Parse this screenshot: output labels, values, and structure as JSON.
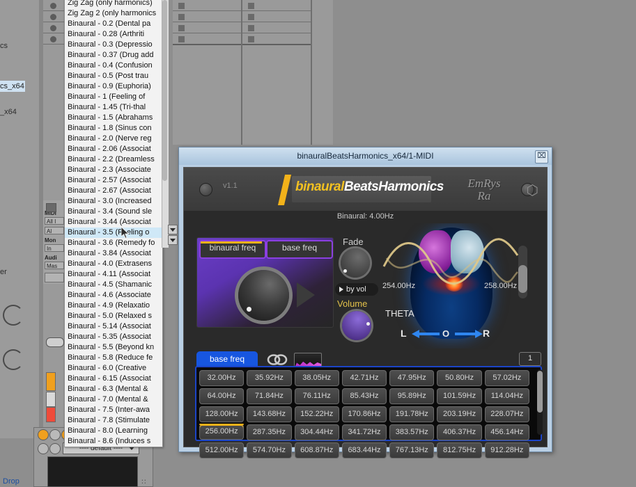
{
  "daw": {
    "browser": {
      "text_1": "cs",
      "selected_item": "cs_x64",
      "text_2": "_x64",
      "text_3": "er"
    },
    "mixer": {
      "midi_from_label": "MIDI",
      "midi_from_value": "All I",
      "midi_channel_value": "Al",
      "monitor_label": "Mon",
      "monitor_value": "In",
      "audio_to_label": "Audi",
      "audio_to_value": "Mas"
    },
    "rack": {
      "preset_value": "---- default ----",
      "drop_label": "Drop",
      "grip": "∶∶"
    }
  },
  "preset_list": {
    "items": [
      {
        "label": "Zig Zag (only harmonics)",
        "selected": false
      },
      {
        "label": "Zig Zag 2 (only harmonics",
        "selected": false
      },
      {
        "label": "Binaural - 0.2 (Dental pa",
        "selected": false
      },
      {
        "label": "Binaural - 0.28 (Arthriti",
        "selected": false
      },
      {
        "label": "Binaural - 0.3 (Depressio",
        "selected": false
      },
      {
        "label": "Binaural - 0.37 (Drug add",
        "selected": false
      },
      {
        "label": "Binaural - 0.4 (Confusion",
        "selected": false
      },
      {
        "label": "Binaural - 0.5 (Post trau",
        "selected": false
      },
      {
        "label": "Binaural - 0.9 (Euphoria)",
        "selected": false
      },
      {
        "label": "Binaural - 1 (Feeling of",
        "selected": false
      },
      {
        "label": "Binaural - 1.45 (Tri-thal",
        "selected": false
      },
      {
        "label": "Binaural - 1.5 (Abrahams",
        "selected": false
      },
      {
        "label": "Binaural - 1.8 (Sinus con",
        "selected": false
      },
      {
        "label": "Binaural - 2.0 (Nerve reg",
        "selected": false
      },
      {
        "label": "Binaural - 2.06 (Associat",
        "selected": false
      },
      {
        "label": "Binaural - 2.2 (Dreamless",
        "selected": false
      },
      {
        "label": "Binaural - 2.3 (Associate",
        "selected": false
      },
      {
        "label": "Binaural - 2.57 (Associat",
        "selected": false
      },
      {
        "label": "Binaural - 2.67 (Associat",
        "selected": false
      },
      {
        "label": "Binaural - 3.0 (Increased",
        "selected": false
      },
      {
        "label": "Binaural - 3.4 (Sound sle",
        "selected": false
      },
      {
        "label": "Binaural - 3.44 (Associat",
        "selected": false
      },
      {
        "label": "Binaural - 3.5 (Feeling o",
        "selected": true
      },
      {
        "label": "Binaural - 3.6 (Remedy fo",
        "selected": false
      },
      {
        "label": "Binaural - 3.84 (Associat",
        "selected": false
      },
      {
        "label": "Binaural - 4.0 (Extrasens",
        "selected": false
      },
      {
        "label": "Binaural - 4.11 (Associat",
        "selected": false
      },
      {
        "label": "Binaural - 4.5 (Shamanic",
        "selected": false
      },
      {
        "label": "Binaural - 4.6 (Associate",
        "selected": false
      },
      {
        "label": "Binaural - 4.9 (Relaxatio",
        "selected": false
      },
      {
        "label": "Binaural - 5.0 (Relaxed s",
        "selected": false
      },
      {
        "label": "Binaural - 5.14 (Associat",
        "selected": false
      },
      {
        "label": "Binaural - 5.35 (Associat",
        "selected": false
      },
      {
        "label": "Binaural - 5.5 (Beyond kn",
        "selected": false
      },
      {
        "label": "Binaural - 5.8 (Reduce fe",
        "selected": false
      },
      {
        "label": "Binaural - 6.0 (Creative",
        "selected": false
      },
      {
        "label": "Binaural - 6.15 (Associat",
        "selected": false
      },
      {
        "label": "Binaural - 6.3 (Mental &",
        "selected": false
      },
      {
        "label": "Binaural - 7.0 (Mental &",
        "selected": false
      },
      {
        "label": "Binaural - 7.5 (Inter-awa",
        "selected": false
      },
      {
        "label": "Binaural - 7.8 (Stimulate",
        "selected": false
      },
      {
        "label": "Binaural - 8.0 (Learning",
        "selected": false
      },
      {
        "label": "Binaural - 8.6 (Induces s",
        "selected": false
      }
    ]
  },
  "plugin": {
    "window_title": "binauralBeatsHarmonics_x64/1-MIDI",
    "close_label": "⌧",
    "version": "v1.1",
    "logo_prefix": "binaural",
    "logo_suffix": "BeatsHarmonics",
    "brand_line1": "EmRys",
    "brand_line2": "Ra",
    "brand_cube": "⬡",
    "readout": "Binaural: 4.00Hz",
    "controls": {
      "binaural_freq_label": "binaural freq",
      "base_freq_label": "base freq",
      "fade_label": "Fade",
      "by_vol_label": "by vol",
      "volume_label": "Volume"
    },
    "brain": {
      "freq_left": "254.00Hz",
      "freq_right": "258.00Hz",
      "band": "THETA",
      "pan_left": "L",
      "pan_center": "O",
      "pan_right": "R"
    },
    "tabs": {
      "base_freq_tab": "base freq",
      "link_icon": "link-icon",
      "spectrum_icon": "spectrum-icon",
      "page_number": "1"
    },
    "freq_grid": {
      "rows": [
        [
          "32.00Hz",
          "35.92Hz",
          "38.05Hz",
          "42.71Hz",
          "47.95Hz",
          "50.80Hz",
          "57.02Hz"
        ],
        [
          "64.00Hz",
          "71.84Hz",
          "76.11Hz",
          "85.43Hz",
          "95.89Hz",
          "101.59Hz",
          "114.04Hz"
        ],
        [
          "128.00Hz",
          "143.68Hz",
          "152.22Hz",
          "170.86Hz",
          "191.78Hz",
          "203.19Hz",
          "228.07Hz"
        ],
        [
          "256.00Hz",
          "287.35Hz",
          "304.44Hz",
          "341.72Hz",
          "383.57Hz",
          "406.37Hz",
          "456.14Hz"
        ],
        [
          "512.00Hz",
          "574.70Hz",
          "608.87Hz",
          "683.44Hz",
          "767.13Hz",
          "812.75Hz",
          "912.28Hz"
        ]
      ],
      "active_row": 3,
      "active_col": 0
    }
  },
  "colors": {
    "accent_orange": "#f2b21a",
    "accent_purple": "#8b3fe0",
    "accent_blue": "#1756e0",
    "selection_blue": "#cfe8f7",
    "plugin_bg": "#2a2a2a"
  }
}
